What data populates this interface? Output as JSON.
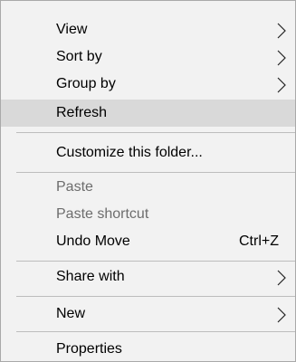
{
  "menu": {
    "items": [
      {
        "label": "View",
        "icon": "chevron-right-icon"
      },
      {
        "label": "Sort by",
        "icon": "chevron-right-icon"
      },
      {
        "label": "Group by",
        "icon": "chevron-right-icon"
      },
      {
        "label": "Refresh"
      },
      {
        "label": "Customize this folder..."
      },
      {
        "label": "Paste"
      },
      {
        "label": "Paste shortcut"
      },
      {
        "label": "Undo Move",
        "shortcut": "Ctrl+Z"
      },
      {
        "label": "Share with",
        "icon": "chevron-right-icon"
      },
      {
        "label": "New",
        "icon": "chevron-right-icon"
      },
      {
        "label": "Properties"
      }
    ],
    "hovered_item": "Refresh",
    "disabled_items": [
      "Paste",
      "Paste shortcut"
    ]
  },
  "colors": {
    "menu_background": "#f2f2f2",
    "hover_background": "#d9d9d9",
    "disabled_text": "#6d6d6d",
    "separator": "#bdbdbd"
  }
}
